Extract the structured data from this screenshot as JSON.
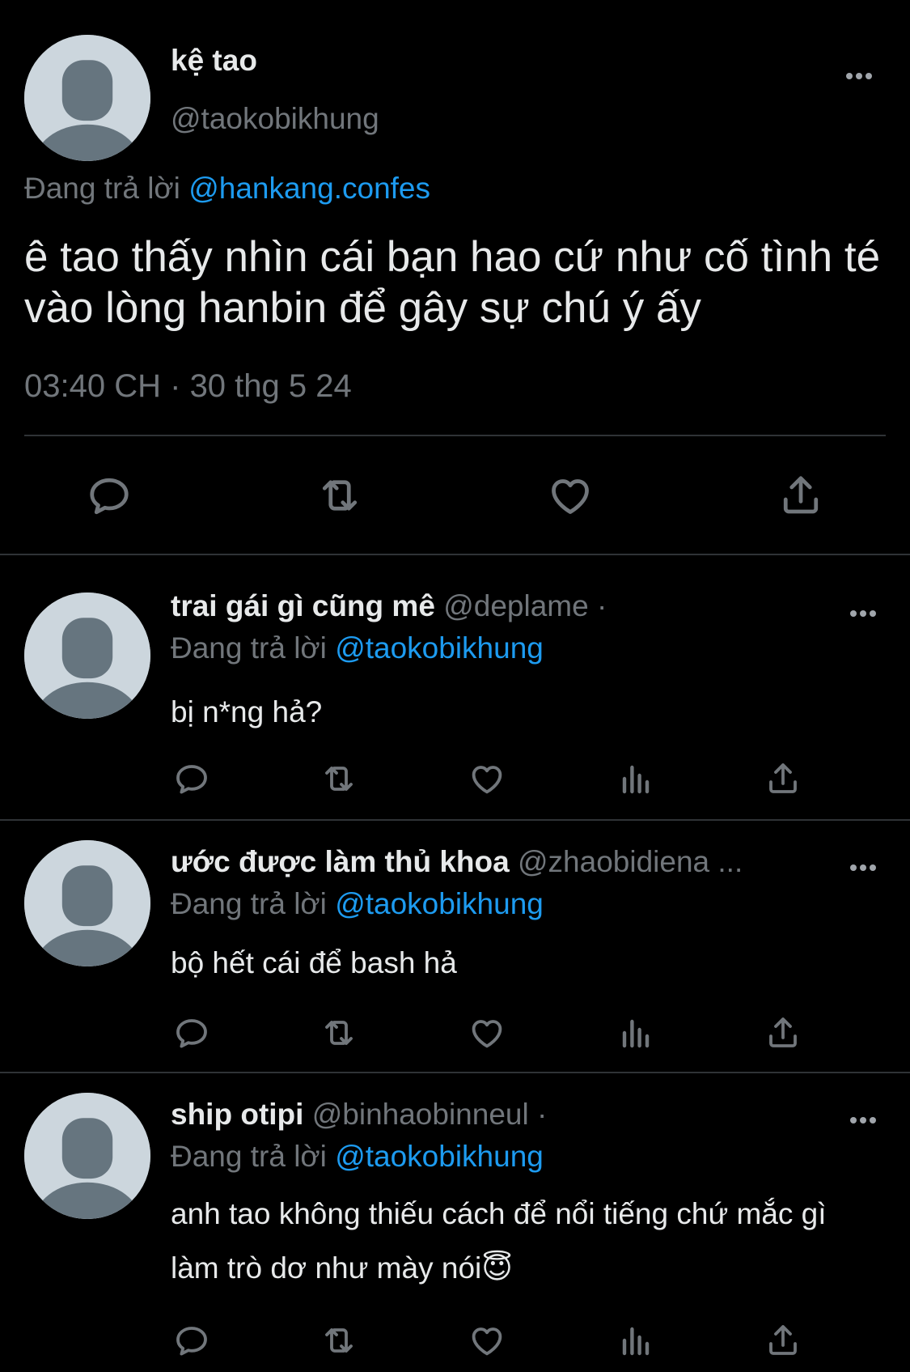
{
  "main_tweet": {
    "name": "kệ tao",
    "handle": "@taokobikhung",
    "reply_prefix": "Đang trả lời",
    "reply_to": "@hankang.confes",
    "text": "ê tao thấy nhìn cái bạn hao cứ như cố tình té vào lòng hanbin để gây sự chú ý ấy",
    "time": "03:40 CH",
    "separator": "·",
    "date": "30 thg 5 24"
  },
  "replies": [
    {
      "name": "trai gái gì cũng mê",
      "handle": "@deplame ·",
      "reply_prefix": "Đang trả lời",
      "reply_to": "@taokobikhung",
      "text": "bị n*ng hả?"
    },
    {
      "name": "ước được làm thủ khoa",
      "handle": "@zhaobidiena ...",
      "reply_prefix": "Đang trả lời",
      "reply_to": "@taokobikhung",
      "text": "bộ hết cái để bash hả"
    },
    {
      "name": "ship otipi",
      "handle": "@binhaobinneul ·",
      "reply_prefix": "Đang trả lời",
      "reply_to": "@taokobikhung",
      "text": "anh tao không thiếu cách để nổi tiếng chứ mắc gì làm trò dơ như mày nói😇"
    }
  ],
  "colors": {
    "background": "#000000",
    "primary_text": "#e7e9ea",
    "secondary_text": "#71767b",
    "link": "#1d9bf0",
    "divider": "#2f3336",
    "avatar_bg": "#ccd6dd",
    "avatar_figure": "#66757f"
  },
  "icons": {
    "actions_main": [
      "reply-icon",
      "retweet-icon",
      "like-icon",
      "share-icon"
    ],
    "actions_reply": [
      "reply-icon",
      "retweet-icon",
      "like-icon",
      "views-icon",
      "share-icon"
    ],
    "more": "more-options-icon"
  }
}
